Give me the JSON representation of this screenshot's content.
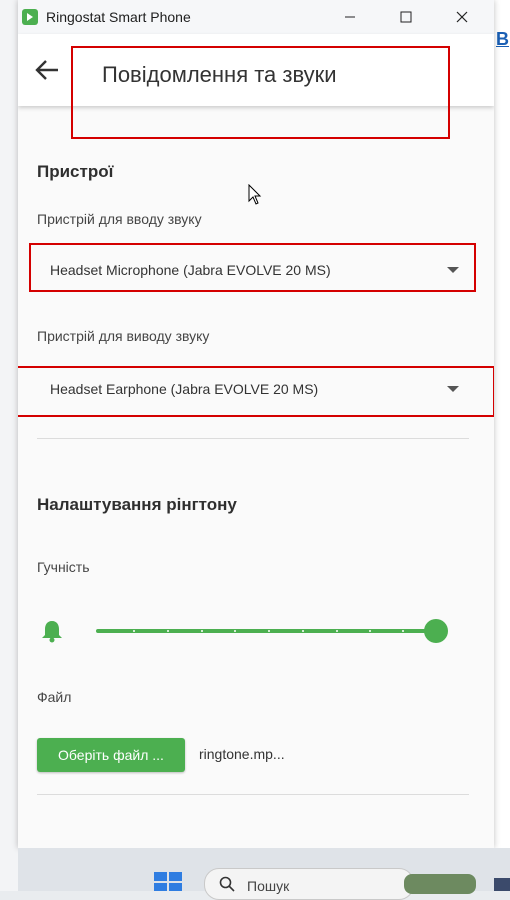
{
  "window": {
    "app_title": "Ringostat Smart Phone",
    "controls": [
      "minimize",
      "maximize",
      "close"
    ]
  },
  "header": {
    "back_icon": "arrow-left-icon",
    "title": "Повідомлення та звуки"
  },
  "devices": {
    "section_title": "Пристрої",
    "input_label": "Пристрій для вводу звуку",
    "input_value": "Headset Microphone (Jabra EVOLVE 20 MS)",
    "output_label": "Пристрій для виводу звуку",
    "output_value": "Headset Earphone (Jabra EVOLVE 20 MS)"
  },
  "ringtone": {
    "section_title": "Налаштування рінгтону",
    "volume_label": "Гучність",
    "volume_level": 1.0,
    "file_label": "Файл",
    "choose_button": "Оберіть файл ...",
    "file_name": "ringtone.mp..."
  },
  "background": {
    "right_edge_text": "B"
  },
  "taskbar": {
    "search_placeholder": "Пошук"
  },
  "colors": {
    "accent": "#4caf50",
    "highlight_box": "#d40000"
  }
}
